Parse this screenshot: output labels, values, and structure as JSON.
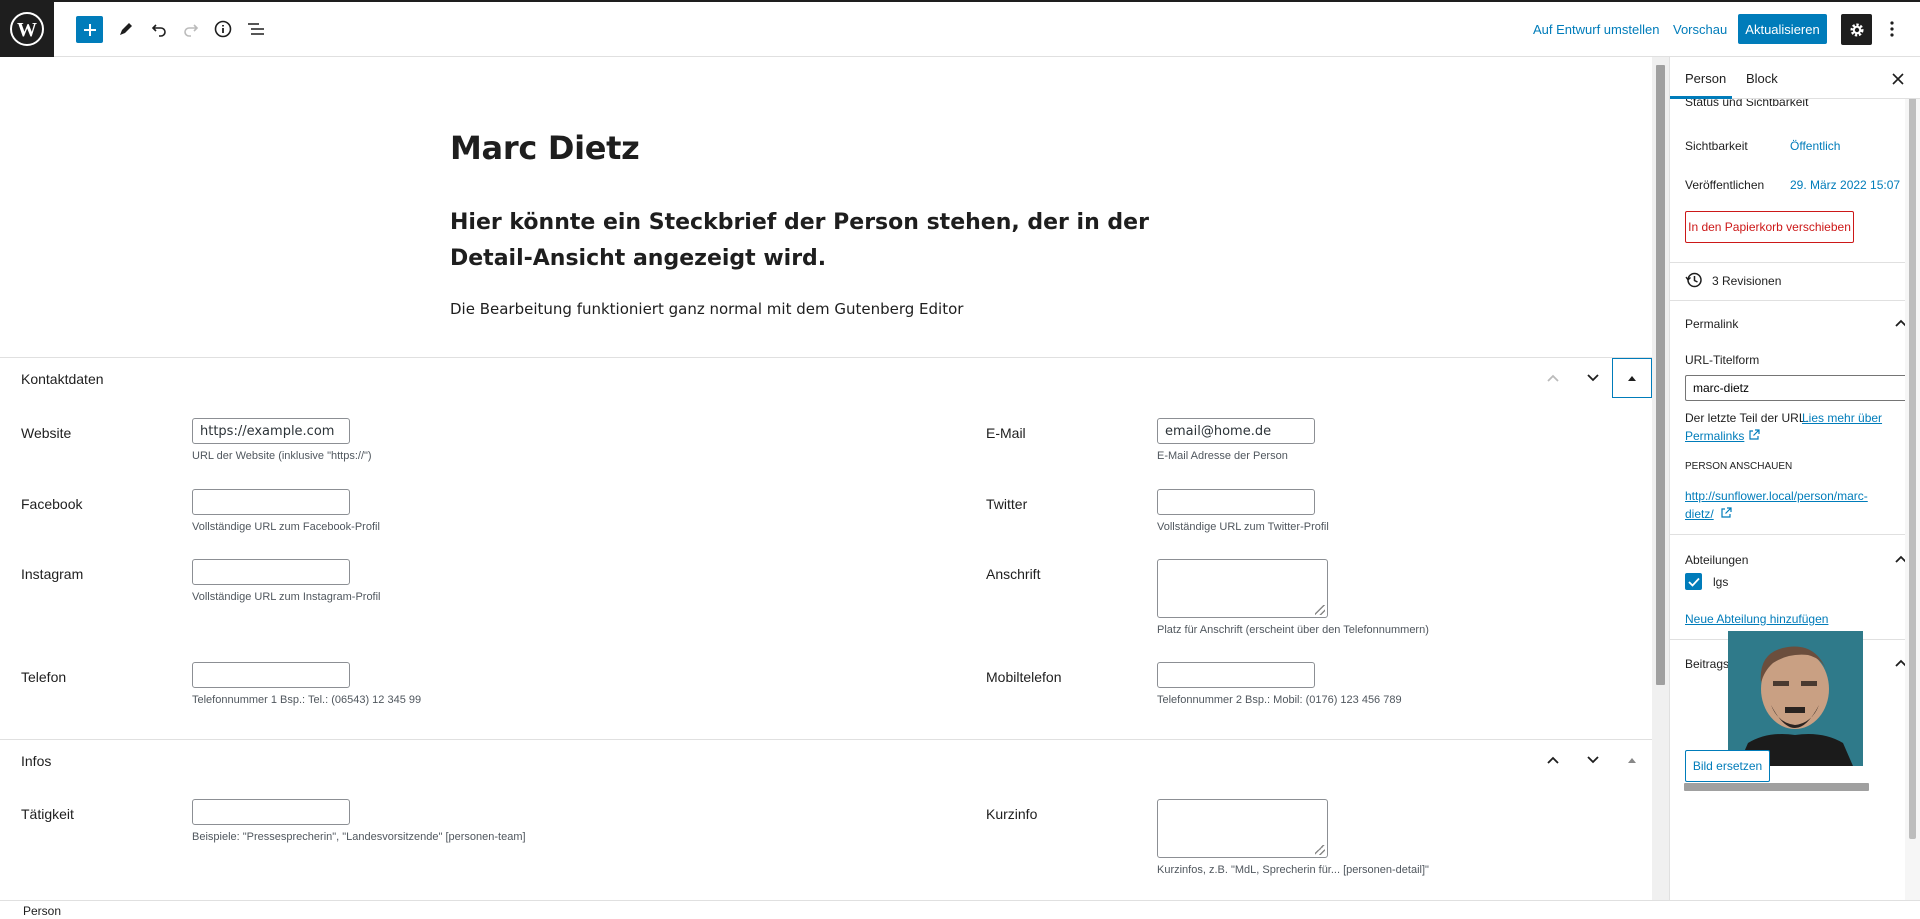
{
  "toolbar": {
    "add_icon": "plus-icon",
    "tools_icon": "pencil-icon",
    "undo_icon": "undo-icon",
    "redo_icon": "redo-icon",
    "details_icon": "info-icon",
    "outline_icon": "list-view-icon",
    "switch_draft": "Auf Entwurf umstellen",
    "preview": "Vorschau",
    "update": "Aktualisieren",
    "settings_icon": "gear-icon",
    "more_icon": "more-vertical-icon"
  },
  "post": {
    "title": "Marc Dietz",
    "heading": "Hier könnte ein Steckbrief der Person stehen, der in der Detail-Ansicht angezeigt wird.",
    "paragraph": "Die Bearbeitung funktioniert ganz normal mit dem Gutenberg Editor"
  },
  "kontakt": {
    "title": "Kontaktdaten",
    "website": {
      "label": "Website",
      "value": "https://example.com",
      "desc": "URL der Website (inklusive \"https://\")"
    },
    "email": {
      "label": "E-Mail",
      "value": "email@home.de",
      "desc": "E-Mail Adresse der Person"
    },
    "facebook": {
      "label": "Facebook",
      "value": "",
      "desc": "Vollständige URL zum Facebook-Profil"
    },
    "twitter": {
      "label": "Twitter",
      "value": "",
      "desc": "Vollständige URL zum Twitter-Profil"
    },
    "instagram": {
      "label": "Instagram",
      "value": "",
      "desc": "Vollständige URL zum Instagram-Profil"
    },
    "anschrift": {
      "label": "Anschrift",
      "value": "",
      "desc": "Platz für Anschrift (erscheint über den Telefonnummern)"
    },
    "telefon": {
      "label": "Telefon",
      "value": "",
      "desc": "Telefonnummer 1 Bsp.: Tel.: (06543) 12 345 99"
    },
    "mobil": {
      "label": "Mobiltelefon",
      "value": "",
      "desc": "Telefonnummer 2 Bsp.: Mobil: (0176) 123 456 789"
    }
  },
  "infos": {
    "title": "Infos",
    "taetigkeit": {
      "label": "Tätigkeit",
      "value": "",
      "desc": "Beispiele: \"Pressesprecherin\", \"Landesvorsitzende\" [personen-team]"
    },
    "kurzinfo": {
      "label": "Kurzinfo",
      "value": "",
      "desc": "Kurzinfos, z.B. \"MdL, Sprecherin für... [personen-detail]\""
    }
  },
  "footer": {
    "breadcrumb": "Person"
  },
  "sidebar": {
    "tab_person": "Person",
    "tab_block": "Block",
    "status_title": "Status und Sichtbarkeit",
    "visibility_label": "Sichtbarkeit",
    "visibility_value": "Öffentlich",
    "publish_label": "Veröffentlichen",
    "publish_value": "29. März 2022 15:07",
    "trash": "In den Papierkorb verschieben",
    "revisions": "3 Revisionen",
    "permalink_title": "Permalink",
    "slug_label": "URL-Titelform",
    "slug_value": "marc-dietz",
    "slug_help": "Der letzte Teil der URL.",
    "slug_help_link_1": "Lies mehr über",
    "slug_help_link_2": "Permalinks",
    "view_label": "PERSON ANSCHAUEN",
    "view_link_1": "http://sunflower.local/person/marc-",
    "view_link_2": "dietz/",
    "dept_title": "Abteilungen",
    "dept_item": "lgs",
    "dept_add": "Neue Abteilung hinzufügen",
    "image_title": "Beitragsbild",
    "replace_image": "Bild ersetzen"
  },
  "colors": {
    "accent": "#007cba",
    "danger": "#cc1818",
    "dark": "#1e1e1e"
  }
}
